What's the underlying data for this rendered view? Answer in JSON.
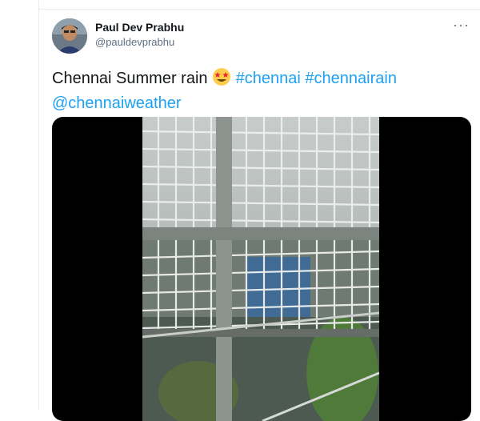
{
  "tweet": {
    "author_name": "Paul Dev Prabhu",
    "author_handle": "@pauldevprabhu",
    "more_label": "···",
    "text_main": "Chennai Summer rain",
    "hashtags": [
      "#chennai",
      "#chennairain"
    ],
    "mention": "@chennaiweather",
    "emoji": "star-struck-emoji"
  },
  "media": {
    "type": "video",
    "subject": "rain-through-balcony-grille"
  },
  "colors": {
    "link": "#1da1f2",
    "text": "#14171a",
    "muted": "#5b7083"
  }
}
